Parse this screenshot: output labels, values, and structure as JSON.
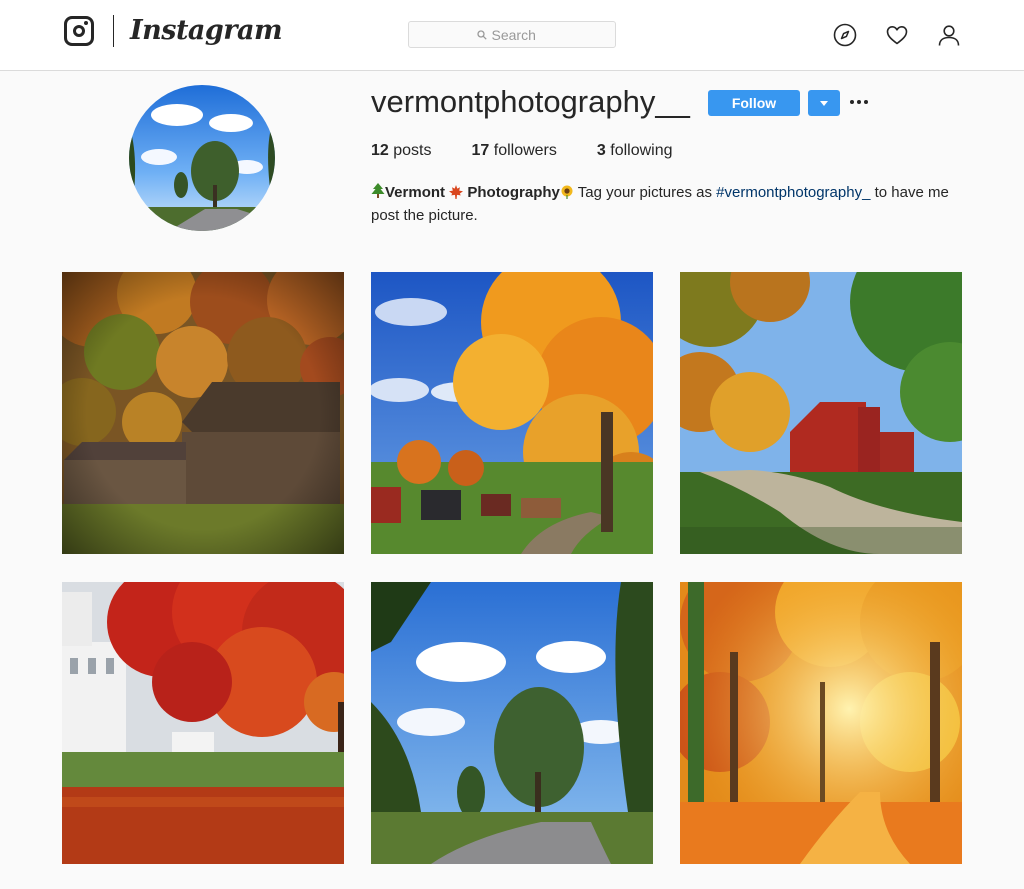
{
  "header": {
    "wordmark": "Instagram",
    "search_placeholder": "Search",
    "nav": [
      {
        "icon": "compass-icon",
        "label": "Explore"
      },
      {
        "icon": "heart-icon",
        "label": "Activity"
      },
      {
        "icon": "user-icon",
        "label": "Profile"
      }
    ]
  },
  "profile": {
    "username": "vermontphotography__",
    "follow_label": "Follow",
    "stats": {
      "posts_count": "12",
      "posts_label": "posts",
      "followers_count": "17",
      "followers_label": "followers",
      "following_count": "3",
      "following_label": "following"
    },
    "bio": {
      "name_part1": "Vermont",
      "name_part2": "Photography",
      "text_before_tag": " Tag your pictures as ",
      "hashtag": "#vermontphotography_",
      "text_after_tag": " to have me post the picture."
    }
  },
  "posts": [
    {
      "subject": "weathered barn with autumn hillside"
    },
    {
      "subject": "orange maple tree over farm village"
    },
    {
      "subject": "red barn beside country road"
    },
    {
      "subject": "red maple over white church and lawn"
    },
    {
      "subject": "tree and country road under blue sky"
    },
    {
      "subject": "golden autumn forest path"
    }
  ],
  "colors": {
    "accent": "#3897f0",
    "link": "#003569",
    "text": "#262626",
    "border": "#dbdbdb",
    "background": "#fafafa"
  }
}
